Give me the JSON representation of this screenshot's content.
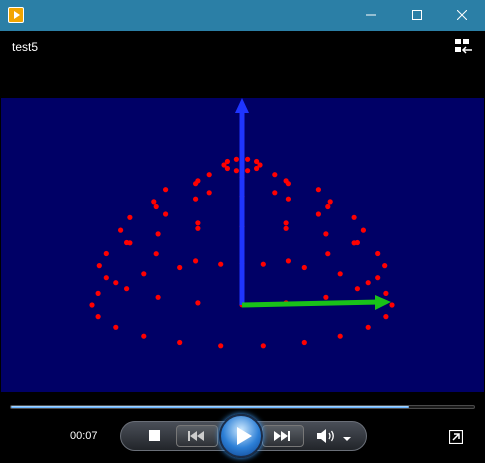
{
  "window": {
    "title": "",
    "icon": "media-player-icon",
    "controls": [
      "minimize-icon",
      "maximize-icon",
      "close-icon"
    ]
  },
  "player": {
    "media_title": "test5",
    "layout_icon": "playlist-layout-icon",
    "elapsed_time": "00:07",
    "progress_fraction": 0.86,
    "controls": {
      "stop": "stop-icon",
      "previous": "skip-previous-icon",
      "play": "play-icon",
      "next": "skip-next-icon",
      "volume": "volume-icon",
      "volume_menu": "chevron-down-icon",
      "switch_view": "switch-to-library-icon"
    }
  },
  "scene": {
    "background_color": "#000066",
    "axis_z_color": "#1f35ff",
    "axis_x_color": "#19c219",
    "point_color": "#ff0000"
  }
}
